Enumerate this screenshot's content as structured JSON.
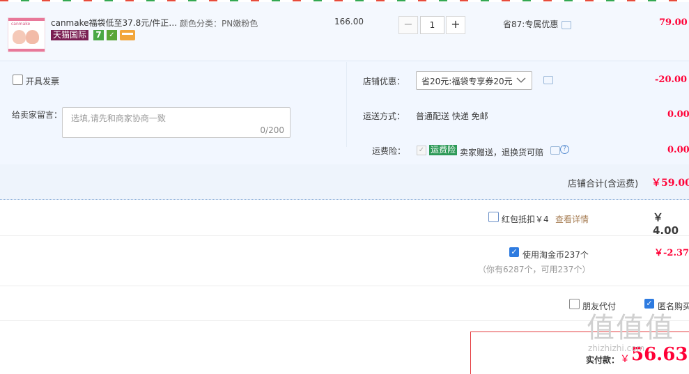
{
  "item": {
    "title": "canmake福袋低至37.8元/件正…",
    "sku_label": "颜色分类：PN嫩粉色",
    "unit_price": "166.00",
    "quantity": "1",
    "promo": "省87:专属优惠",
    "subtotal": "79.00",
    "thumb_text": "canmake",
    "tags": {
      "tmall": "天猫国际",
      "seven": "7"
    }
  },
  "invoice": {
    "label": "开具发票"
  },
  "memo": {
    "label": "给卖家留言：",
    "placeholder": "选填,请先和商家协商一致",
    "counter": "0/200"
  },
  "shop_coupon": {
    "label": "店铺优惠：",
    "selected": "省20元:福袋专享券20元",
    "amount": "-20.00"
  },
  "shipping": {
    "label": "运送方式：",
    "value": "普通配送 快递 免邮",
    "amount": "0.00"
  },
  "insurance": {
    "label": "运费险：",
    "badge": "运费险",
    "desc": "卖家赠送，退换货可赔",
    "amount": "0.00"
  },
  "shop_total": {
    "label": "店铺合计(含运费)",
    "amount": "￥59.00"
  },
  "redpacket": {
    "label": "红包抵扣￥4",
    "link": "查看详情",
    "amount": "￥ 4.00"
  },
  "taojinbi": {
    "label": "使用淘金币237个",
    "note": "（你有6287个，可用237个）",
    "amount": "￥-2.37"
  },
  "options": {
    "friend_pay": "朋友代付",
    "anonymous": "匿名购买"
  },
  "payment": {
    "label": "实付款：",
    "currency": "￥",
    "amount": "56.63"
  },
  "watermark": {
    "brand": "值值值",
    "url": "zhizhizhi.com"
  },
  "colors": {
    "accent_red": "#ff0036",
    "tmall_tag": "#7a1e52",
    "checkbox_blue": "#2e7be0"
  }
}
